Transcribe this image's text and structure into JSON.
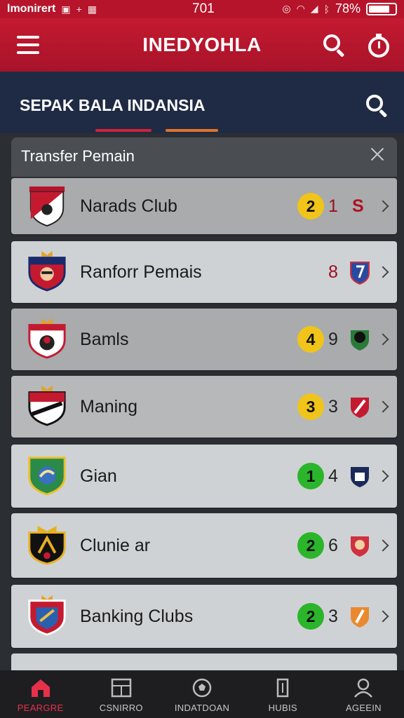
{
  "status_bar": {
    "carrier": "lmonirert",
    "time": "701",
    "battery": "78%"
  },
  "app_bar": {
    "title": "INEDYOHLA"
  },
  "section": {
    "title": "SEPAK BALA INDANSIA"
  },
  "panel": {
    "title": "Transfer Pemain"
  },
  "clubs": [
    {
      "name": "Narads Club",
      "badge": "2",
      "badge_color": "#f0c419",
      "score": "1",
      "extra": "S"
    },
    {
      "name": "Ranforr Pemais",
      "badge": "",
      "score": "8"
    },
    {
      "name": "Bamls",
      "badge": "4",
      "badge_color": "#f0c419",
      "score": "9"
    },
    {
      "name": "Maning",
      "badge": "3",
      "badge_color": "#f0c419",
      "score": "3"
    },
    {
      "name": "Gian",
      "badge": "1",
      "badge_color": "#2bb52b",
      "score": "4"
    },
    {
      "name": "Clunie ar",
      "badge": "2",
      "badge_color": "#2bb52b",
      "score": "6"
    },
    {
      "name": "Banking Clubs",
      "badge": "2",
      "badge_color": "#2bb52b",
      "score": "3"
    }
  ],
  "bottom_nav": [
    {
      "label": "PEARGRE",
      "icon": "home-icon",
      "active": true
    },
    {
      "label": "CSNIRRO",
      "icon": "scoreboard-icon",
      "active": false
    },
    {
      "label": "INDATDOAN",
      "icon": "ball-icon",
      "active": false
    },
    {
      "label": "HUBIS",
      "icon": "jersey-icon",
      "active": false
    },
    {
      "label": "AGEEIN",
      "icon": "person-icon",
      "active": false
    }
  ],
  "colors": {
    "brand_red": "#b5142a",
    "section_navy": "#1f2b44",
    "accent_orange": "#e0742c"
  }
}
